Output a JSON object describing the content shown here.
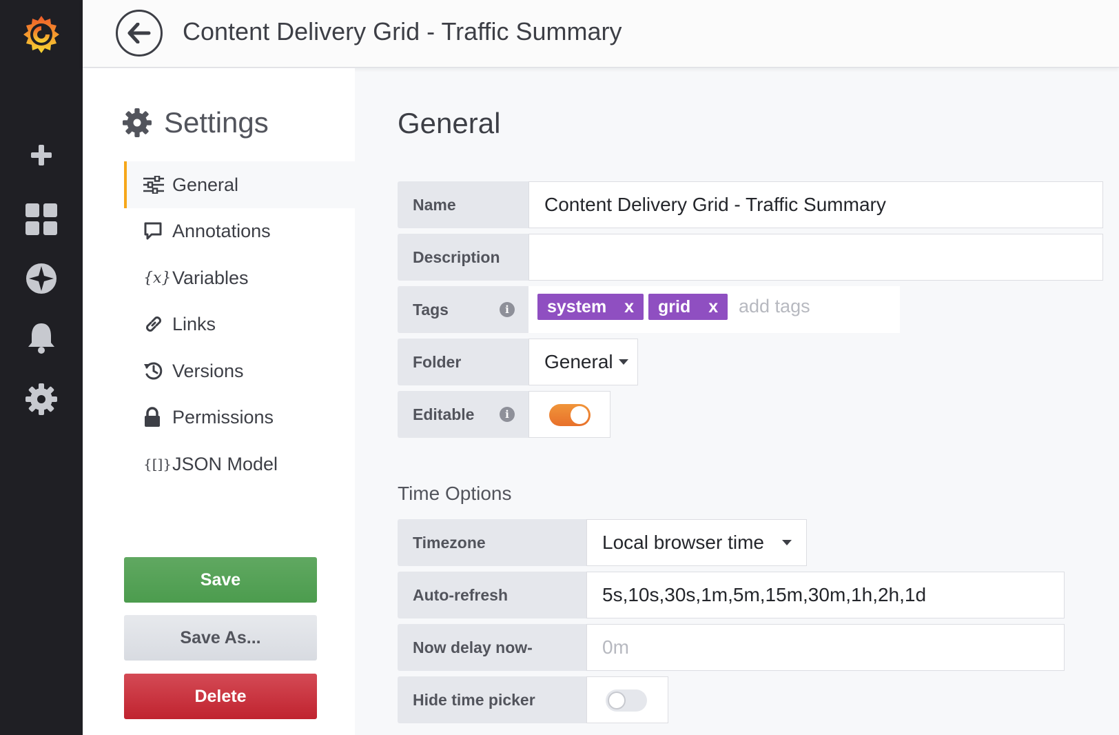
{
  "header": {
    "title": "Content Delivery Grid - Traffic Summary"
  },
  "sidenav": {
    "icons": [
      "grafana-logo-icon",
      "plus-icon",
      "dashboards-icon",
      "explore-compass-icon",
      "bell-icon",
      "gear-icon"
    ]
  },
  "settings": {
    "heading": "Settings",
    "menu": [
      {
        "label": "General",
        "icon": "sliders-icon",
        "active": true
      },
      {
        "label": "Annotations",
        "icon": "comment-icon",
        "active": false
      },
      {
        "label": "Variables",
        "icon": "variable-icon",
        "glyph": "{x}",
        "active": false
      },
      {
        "label": "Links",
        "icon": "link-icon",
        "active": false
      },
      {
        "label": "Versions",
        "icon": "history-icon",
        "active": false
      },
      {
        "label": "Permissions",
        "icon": "lock-icon",
        "active": false
      },
      {
        "label": "JSON Model",
        "icon": "json-icon",
        "glyph": "{[]}",
        "active": false
      }
    ],
    "buttons": {
      "save": "Save",
      "save_as": "Save As...",
      "delete": "Delete"
    }
  },
  "general": {
    "title": "General",
    "name_label": "Name",
    "name_value": "Content Delivery Grid - Traffic Summary",
    "description_label": "Description",
    "description_value": "",
    "tags_label": "Tags",
    "tags": [
      "system",
      "grid"
    ],
    "tag_remove": "x",
    "tags_placeholder": "add tags",
    "folder_label": "Folder",
    "folder_value": "General",
    "editable_label": "Editable",
    "editable_on": true
  },
  "time_options": {
    "title": "Time Options",
    "timezone_label": "Timezone",
    "timezone_value": "Local browser time",
    "autorefresh_label": "Auto-refresh",
    "autorefresh_value": "5s,10s,30s,1m,5m,15m,30m,1h,2h,1d",
    "nowdelay_label": "Now delay now-",
    "nowdelay_placeholder": "0m",
    "hidepicker_label": "Hide time picker",
    "hidepicker_on": false
  },
  "colors": {
    "accent": "#f6a71a",
    "tag": "#8f4fc1",
    "save": "#53a353",
    "delete": "#c7303b",
    "toggle_on": "#ea7c2c"
  }
}
